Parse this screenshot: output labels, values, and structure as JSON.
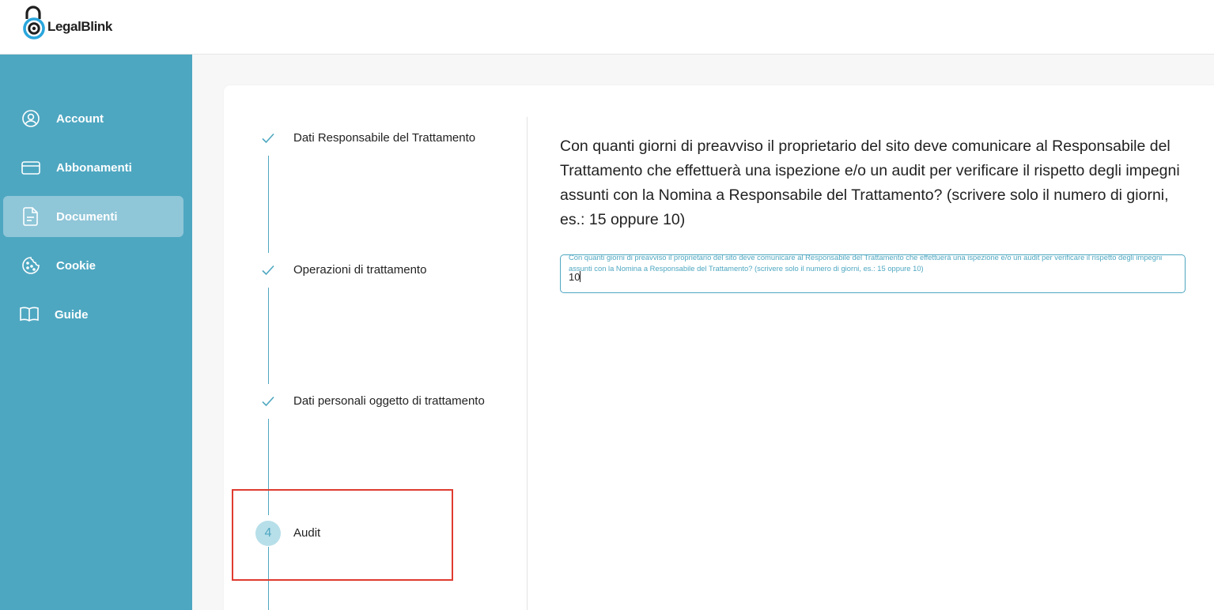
{
  "brand": {
    "name": "LegalBlink",
    "accent_color": "#4ea7c1"
  },
  "sidebar": {
    "items": [
      {
        "label": "Account",
        "icon": "user-circle-icon",
        "active": false
      },
      {
        "label": "Abbonamenti",
        "icon": "credit-card-icon",
        "active": false
      },
      {
        "label": "Documenti",
        "icon": "document-icon",
        "active": true
      },
      {
        "label": "Cookie",
        "icon": "cookie-icon",
        "active": false
      },
      {
        "label": "Guide",
        "icon": "book-icon",
        "active": false
      }
    ]
  },
  "steps": [
    {
      "label": "Dati Responsabile del Trattamento",
      "status": "completed"
    },
    {
      "label": "Operazioni di trattamento",
      "status": "completed"
    },
    {
      "label": "Dati personali oggetto di trattamento",
      "status": "completed"
    },
    {
      "number": "4",
      "label": "Audit",
      "status": "current"
    }
  ],
  "question": {
    "text": "Con quanti giorni di preavviso il proprietario del sito deve comunicare al Responsabile del Trattamento che effettuerà una ispezione e/o un audit per verificare il rispetto degli impegni assunti con la Nomina a Responsabile del Trattamento? (scrivere solo il numero di giorni, es.: 15 oppure 10)",
    "field_label": "Con quanti giorni di preavviso il proprietario del sito deve comunicare al Responsabile del Trattamento che effettuerà una ispezione e/o un audit per verificare il rispetto degli impegni assunti con la Nomina a Responsabile del Trattamento? (scrivere solo il numero di giorni, es.: 15 oppure 10)",
    "value": "10"
  }
}
